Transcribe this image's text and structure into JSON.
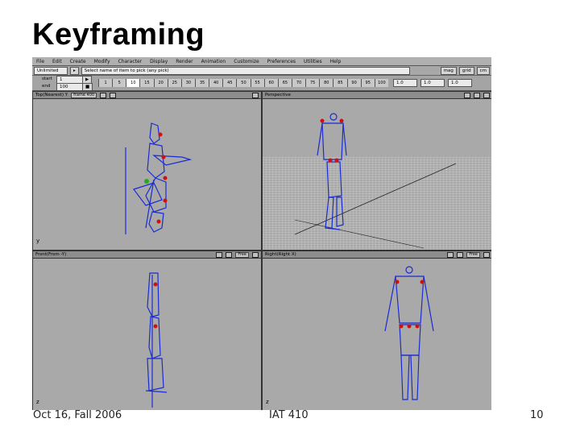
{
  "slide": {
    "title": "Keyframing",
    "footer_left": "Oct 16, Fall 2006",
    "footer_center": "IAT 410",
    "page_number": "10"
  },
  "app": {
    "menu": [
      "File",
      "Edit",
      "Create",
      "Modify",
      "Character",
      "Display",
      "Render",
      "Animation",
      "Customize",
      "Preferences",
      "Utilities",
      "Help"
    ],
    "toolbar": {
      "mode_field": "Unlimited",
      "prompt": "Select name of item to pick (any pick)",
      "right_buttons": [
        "mag",
        "grid",
        "cm"
      ],
      "start_label": "start",
      "end_label": "end",
      "start_value": "1",
      "end_value": "100",
      "frames": [
        "1",
        "5",
        "10",
        "15",
        "20",
        "25",
        "30",
        "35",
        "40",
        "45",
        "50",
        "55",
        "60",
        "65",
        "70",
        "75",
        "80",
        "85",
        "90",
        "95",
        "100"
      ],
      "current_frame_index": 2,
      "right_fields": [
        "1.0",
        "1.0",
        "1.0"
      ]
    },
    "colors": {
      "skeleton": "#1a2cd0",
      "joint": "#d01010",
      "viewport_bg": "#a9a9a9",
      "grid": "#d8d8d8"
    },
    "viewports": [
      {
        "name": "Top(Nearest) Y",
        "field": "frame 400",
        "axis": "y"
      },
      {
        "name": "Perspective",
        "field": "",
        "axis": ""
      },
      {
        "name": "Front(From -Y)",
        "field": "Free",
        "axis": "z"
      },
      {
        "name": "Right(Right X)",
        "field": "Free",
        "axis": "z"
      }
    ]
  }
}
